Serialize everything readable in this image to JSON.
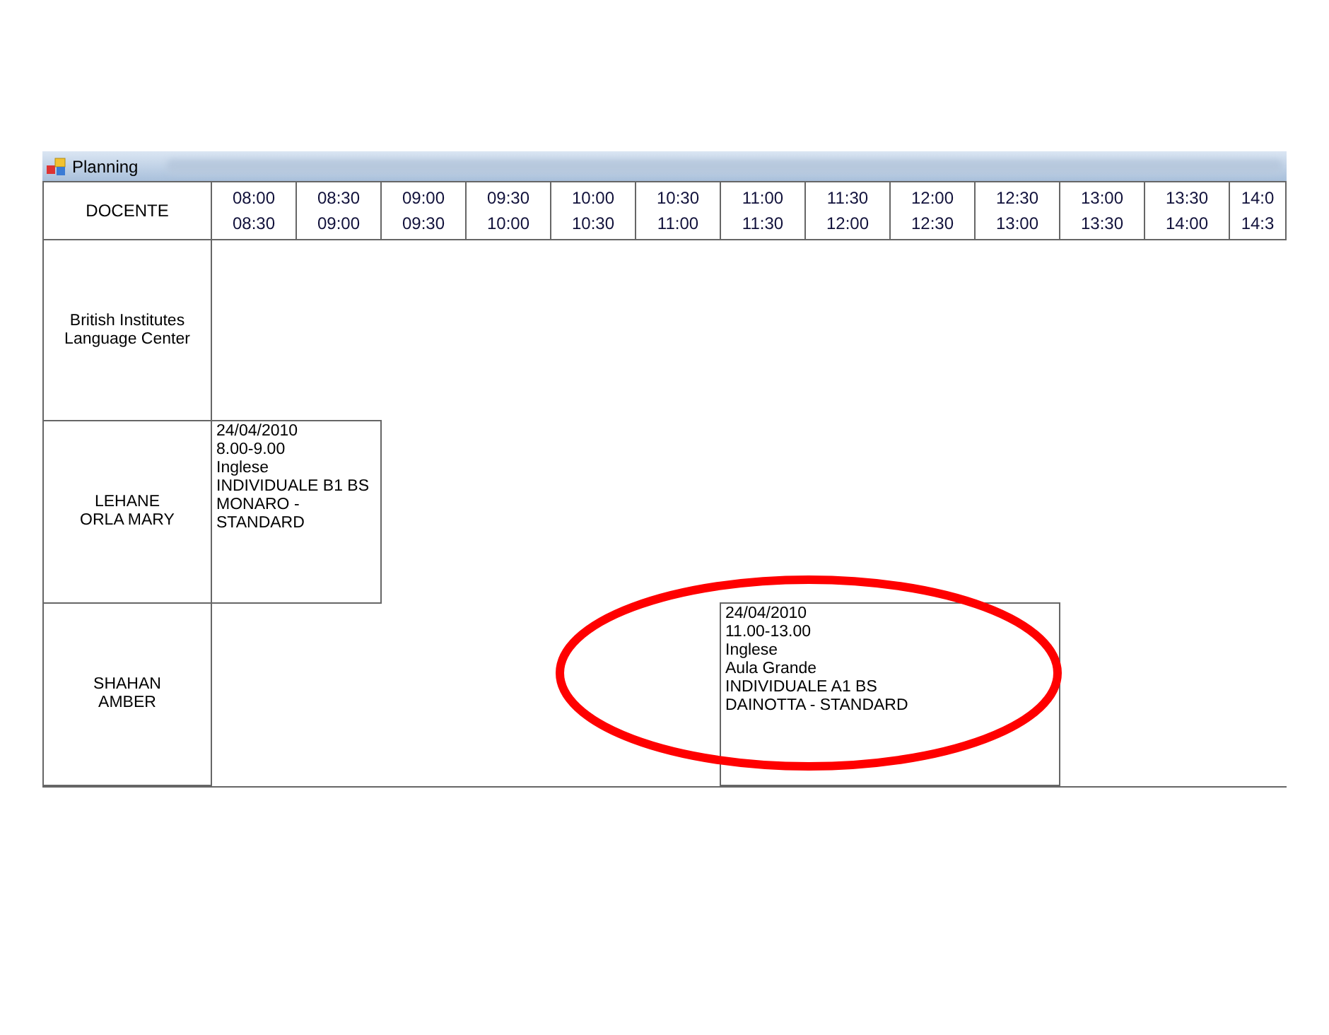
{
  "window": {
    "title": "Planning"
  },
  "header": {
    "label": "DOCENTE"
  },
  "time_slots": [
    {
      "start": "08:00",
      "end": "08:30"
    },
    {
      "start": "08:30",
      "end": "09:00"
    },
    {
      "start": "09:00",
      "end": "09:30"
    },
    {
      "start": "09:30",
      "end": "10:00"
    },
    {
      "start": "10:00",
      "end": "10:30"
    },
    {
      "start": "10:30",
      "end": "11:00"
    },
    {
      "start": "11:00",
      "end": "11:30"
    },
    {
      "start": "11:30",
      "end": "12:00"
    },
    {
      "start": "12:00",
      "end": "12:30"
    },
    {
      "start": "12:30",
      "end": "13:00"
    },
    {
      "start": "13:00",
      "end": "13:30"
    },
    {
      "start": "13:30",
      "end": "14:00"
    },
    {
      "start": "14:0",
      "end": "14:3"
    }
  ],
  "rows": [
    {
      "teacher": [
        "British Institutes",
        "Language Center"
      ],
      "cells": [
        {
          "kind": "empty"
        },
        {
          "kind": "empty"
        },
        {
          "kind": "empty"
        },
        {
          "kind": "empty"
        },
        {
          "kind": "empty"
        },
        {
          "kind": "empty"
        },
        {
          "kind": "empty"
        },
        {
          "kind": "empty"
        },
        {
          "kind": "empty"
        },
        {
          "kind": "empty"
        },
        {
          "kind": "empty"
        },
        {
          "kind": "empty"
        },
        {
          "kind": "empty"
        }
      ]
    },
    {
      "teacher": [
        "LEHANE",
        "ORLA MARY"
      ],
      "cells": [
        {
          "kind": "event",
          "lines": [
            "24/04/2010",
            "8.00-9.00",
            "Inglese",
            "INDIVIDUALE B1 BS",
            "MONARO -",
            "STANDARD"
          ]
        },
        {
          "kind": "continued"
        },
        {
          "kind": "empty"
        },
        {
          "kind": "empty"
        },
        {
          "kind": "empty"
        },
        {
          "kind": "empty"
        },
        {
          "kind": "empty"
        },
        {
          "kind": "empty"
        },
        {
          "kind": "empty"
        },
        {
          "kind": "empty"
        },
        {
          "kind": "empty"
        },
        {
          "kind": "empty"
        },
        {
          "kind": "empty"
        }
      ]
    },
    {
      "teacher": [
        "SHAHAN",
        "AMBER"
      ],
      "cells": [
        {
          "kind": "empty"
        },
        {
          "kind": "empty"
        },
        {
          "kind": "empty"
        },
        {
          "kind": "empty"
        },
        {
          "kind": "empty"
        },
        {
          "kind": "empty"
        },
        {
          "kind": "event",
          "lines": [
            "24/04/2010",
            "11.00-13.00",
            "Inglese",
            "Aula Grande",
            "INDIVIDUALE A1 BS",
            "DAINOTTA - STANDARD"
          ]
        },
        {
          "kind": "continued"
        },
        {
          "kind": "continued"
        },
        {
          "kind": "continued"
        },
        {
          "kind": "empty"
        },
        {
          "kind": "empty"
        },
        {
          "kind": "empty"
        }
      ]
    }
  ]
}
